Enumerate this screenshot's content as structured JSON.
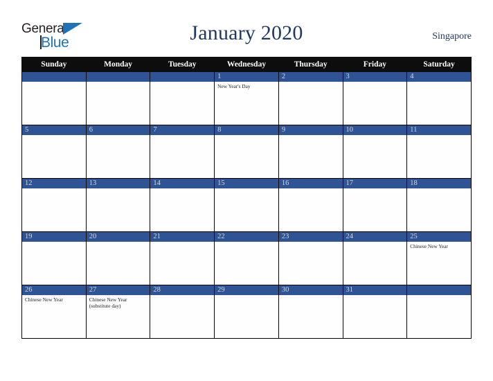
{
  "brand": {
    "name_part1": "General",
    "name_part2": "Blue",
    "triangle_color": "#1f72b8",
    "text_color": "#231f20"
  },
  "header": {
    "title": "January 2020",
    "country": "Singapore",
    "title_color": "#203864"
  },
  "calendar": {
    "header_bg": "#0d0d0d",
    "daynum_band_color": "#2e5496",
    "daynum_text_color": "#d9d9d9",
    "weekday_headers": [
      "Sunday",
      "Monday",
      "Tuesday",
      "Wednesday",
      "Thursday",
      "Friday",
      "Saturday"
    ],
    "weeks": [
      [
        {
          "day": "",
          "events": []
        },
        {
          "day": "",
          "events": []
        },
        {
          "day": "",
          "events": []
        },
        {
          "day": "1",
          "events": [
            "New Year's Day"
          ]
        },
        {
          "day": "2",
          "events": []
        },
        {
          "day": "3",
          "events": []
        },
        {
          "day": "4",
          "events": []
        }
      ],
      [
        {
          "day": "5",
          "events": []
        },
        {
          "day": "6",
          "events": []
        },
        {
          "day": "7",
          "events": []
        },
        {
          "day": "8",
          "events": []
        },
        {
          "day": "9",
          "events": []
        },
        {
          "day": "10",
          "events": []
        },
        {
          "day": "11",
          "events": []
        }
      ],
      [
        {
          "day": "12",
          "events": []
        },
        {
          "day": "13",
          "events": []
        },
        {
          "day": "14",
          "events": []
        },
        {
          "day": "15",
          "events": []
        },
        {
          "day": "16",
          "events": []
        },
        {
          "day": "17",
          "events": []
        },
        {
          "day": "18",
          "events": []
        }
      ],
      [
        {
          "day": "19",
          "events": []
        },
        {
          "day": "20",
          "events": []
        },
        {
          "day": "21",
          "events": []
        },
        {
          "day": "22",
          "events": []
        },
        {
          "day": "23",
          "events": []
        },
        {
          "day": "24",
          "events": []
        },
        {
          "day": "25",
          "events": [
            "Chinese New Year"
          ]
        }
      ],
      [
        {
          "day": "26",
          "events": [
            "Chinese New Year"
          ]
        },
        {
          "day": "27",
          "events": [
            "Chinese New Year (substitute day)"
          ]
        },
        {
          "day": "28",
          "events": []
        },
        {
          "day": "29",
          "events": []
        },
        {
          "day": "30",
          "events": []
        },
        {
          "day": "31",
          "events": []
        },
        {
          "day": "",
          "events": []
        }
      ]
    ]
  }
}
